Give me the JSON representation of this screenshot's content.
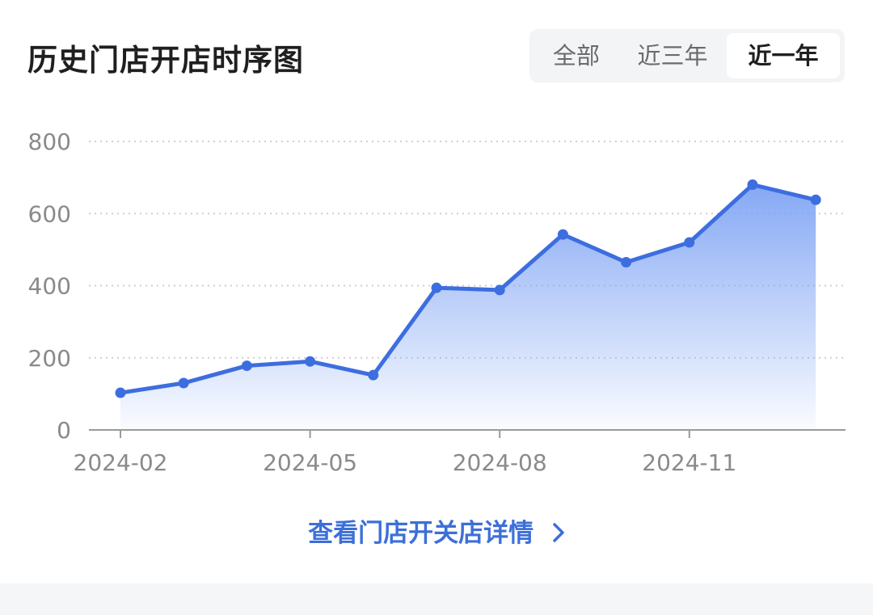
{
  "header": {
    "title": "历史门店开店时序图"
  },
  "range_tabs": [
    {
      "label": "全部",
      "active": false
    },
    {
      "label": "近三年",
      "active": false
    },
    {
      "label": "近一年",
      "active": true
    }
  ],
  "footer": {
    "link_label": "查看门店开关店详情",
    "link_icon": "chevron-right-icon"
  },
  "colors": {
    "line": "#3d6ee0",
    "area_top": "#7fa4f4",
    "grid": "#cfcfcf",
    "axis_text": "#8a8a8a",
    "link": "#3c6fd8"
  },
  "chart_data": {
    "type": "area",
    "x": [
      "2024-02",
      "2024-03",
      "2024-04",
      "2024-05",
      "2024-06",
      "2024-07",
      "2024-08",
      "2024-09",
      "2024-10",
      "2024-11",
      "2024-12",
      "2025-01"
    ],
    "values": [
      103,
      130,
      178,
      190,
      152,
      394,
      388,
      542,
      465,
      520,
      680,
      638
    ],
    "x_tick_labels": [
      "2024-02",
      "2024-05",
      "2024-08",
      "2024-11"
    ],
    "y_ticks": [
      0,
      200,
      400,
      600,
      800
    ],
    "ylim": [
      0,
      800
    ],
    "grid": true
  }
}
